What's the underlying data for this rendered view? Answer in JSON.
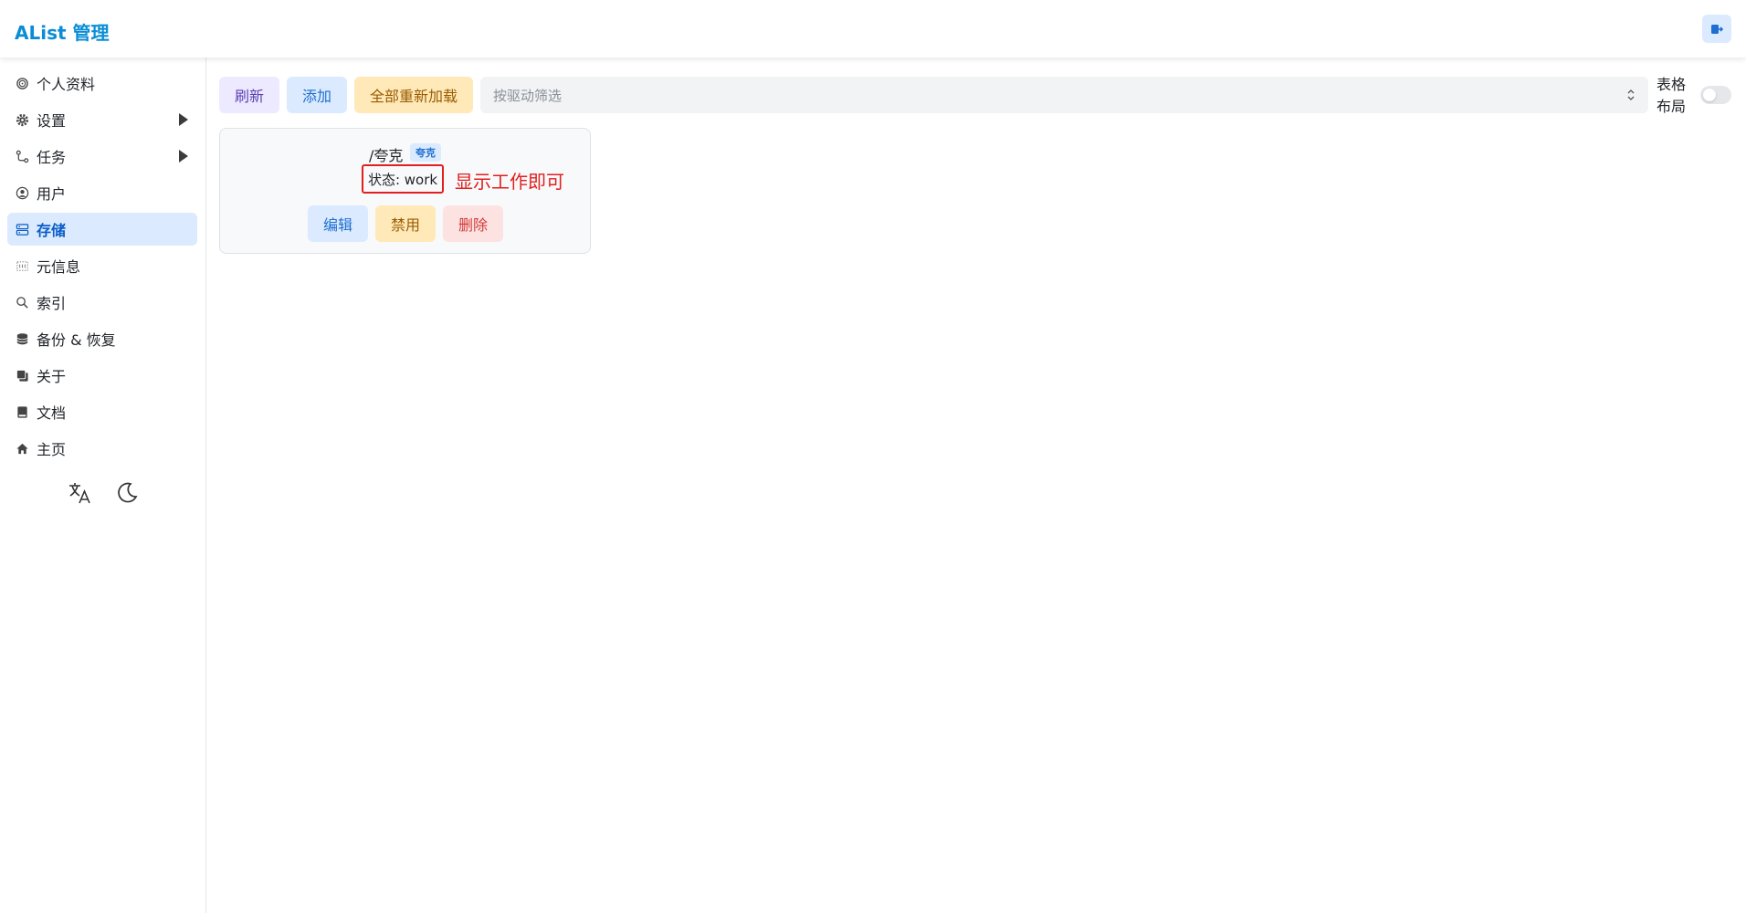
{
  "header": {
    "title": "AList 管理",
    "logout_icon": "logout-icon"
  },
  "sidebar": {
    "items": [
      {
        "label": "个人资料",
        "icon": "fingerprint-icon",
        "has_submenu": false,
        "active": false
      },
      {
        "label": "设置",
        "icon": "gear-icon",
        "has_submenu": true,
        "active": false
      },
      {
        "label": "任务",
        "icon": "route-icon",
        "has_submenu": true,
        "active": false
      },
      {
        "label": "用户",
        "icon": "user-circle-icon",
        "has_submenu": false,
        "active": false
      },
      {
        "label": "存储",
        "icon": "database-server-icon",
        "has_submenu": false,
        "active": true
      },
      {
        "label": "元信息",
        "icon": "metadata-icon",
        "has_submenu": false,
        "active": false
      },
      {
        "label": "索引",
        "icon": "search-icon",
        "has_submenu": false,
        "active": false
      },
      {
        "label": "备份 & 恢复",
        "icon": "database-icon",
        "has_submenu": false,
        "active": false
      },
      {
        "label": "关于",
        "icon": "copy-icon",
        "has_submenu": false,
        "active": false
      },
      {
        "label": "文档",
        "icon": "book-icon",
        "has_submenu": false,
        "active": false
      },
      {
        "label": "主页",
        "icon": "home-icon",
        "has_submenu": false,
        "active": false
      }
    ],
    "tools": {
      "language_icon": "translate-icon",
      "theme_icon": "moon-icon"
    }
  },
  "toolbar": {
    "refresh_label": "刷新",
    "add_label": "添加",
    "reload_all_label": "全部重新加载",
    "filter_placeholder": "按驱动筛选",
    "layout_label_line1": "表格",
    "layout_label_line2": "布局",
    "table_layout_enabled": false
  },
  "storages": [
    {
      "mount_path": "/夸克",
      "driver": "夸克",
      "status": "状态: work",
      "annotation": "显示工作即可",
      "edit_label": "编辑",
      "disable_label": "禁用",
      "delete_label": "删除"
    }
  ],
  "colors": {
    "accent": "#0a8dd6",
    "active_bg": "#dbeafe",
    "annotation": "#e02020"
  }
}
